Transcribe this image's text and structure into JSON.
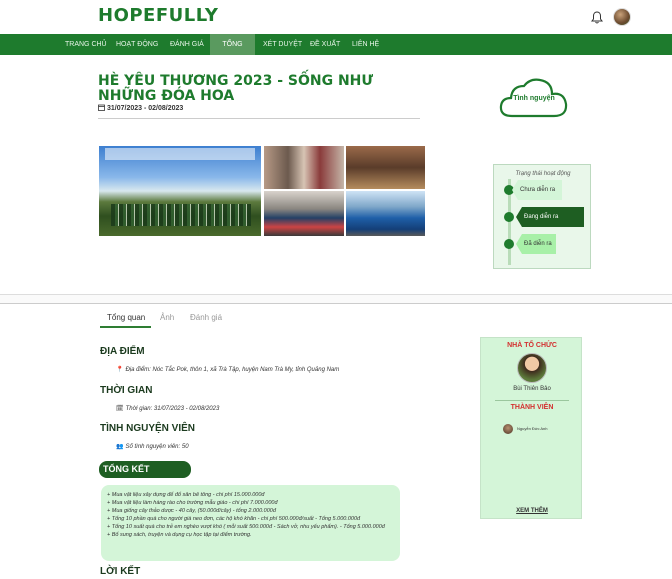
{
  "brand": {
    "logo": "HOPEFULLY"
  },
  "nav": {
    "items": [
      {
        "label": "TRANG CHỦ"
      },
      {
        "label": "HOẠT ĐỘNG"
      },
      {
        "label": "ĐÁNH GIÁ"
      },
      {
        "label": "TỔNG KẾT"
      },
      {
        "label": "XÉT DUYỆT"
      },
      {
        "label": "ĐỀ XUẤT"
      },
      {
        "label": "LIÊN HỆ"
      }
    ],
    "active": "TỔNG KẾT"
  },
  "event": {
    "title": "HÈ YÊU THƯƠNG 2023 - SỐNG NHƯ NHỮNG ĐÓA HOA",
    "date_range": "31/07/2023 - 02/08/2023",
    "category": "Tình nguyện"
  },
  "status": {
    "title": "Trạng thái hoạt động",
    "steps": [
      {
        "label": "Chưa diễn ra"
      },
      {
        "label": "Đang diễn ra"
      },
      {
        "label": "Đã diễn ra"
      }
    ],
    "current": "Đang diễn ra"
  },
  "tabs": [
    {
      "label": "Tổng quan"
    },
    {
      "label": "Ảnh"
    },
    {
      "label": "Đánh giá"
    }
  ],
  "overview": {
    "location_heading": "ĐỊA ĐIỂM",
    "location_text": "Địa điểm: Nóc Tắc Pok, thôn 1, xã Trà Tập, huyện Nam Trà My, tỉnh Quảng Nam",
    "time_heading": "THỜI GIAN",
    "time_text": "Thời gian: 31/07/2023 - 02/08/2023",
    "volunteer_heading": "TÌNH NGUYỆN VIÊN",
    "volunteer_text": "Số tình nguyện viên: 50",
    "summary_heading": "TỔNG KẾT",
    "summary_lines": [
      "+ Mua vật liệu xây dựng để đổ sân bê tông - chi phí 15.000.000đ",
      "+ Mua vật liệu làm hàng rào cho trường mẫu giáo - chi phí 7.000.000đ",
      "+ Mua giống cây thảo dược - 40 cây, (50.000đ/cây) - tổng 2.000.000đ",
      "+ Tổng 10 phần quà cho người già neo đơn, các hộ khó khăn - chi phí 500.000đ/suất - Tổng 5.000.000đ",
      "+ Tổng 10 suất quà cho trẻ em nghèo vượt khó ( mỗi suất 500.000đ - Sách vở, nhu yếu phẩm). - Tổng 5.000.000đ",
      "+ Bổ sung sách, truyện và dụng cụ học tập tại điểm trường."
    ],
    "closing_heading": "LỜI KẾT"
  },
  "organizer": {
    "heading": "NHÀ TỔ CHỨC",
    "name": "Bùi Thiên Bảo",
    "members_heading": "THÀNH VIÊN",
    "members": [
      {
        "name": "Nguyễn Đức Anh"
      }
    ],
    "see_more": "XEM THÊM"
  },
  "colors": {
    "brand_green": "#1e7b2d",
    "nav_active": "#5a9a5f",
    "light_green": "#d4f5d8",
    "accent_red": "#d32f2f"
  }
}
